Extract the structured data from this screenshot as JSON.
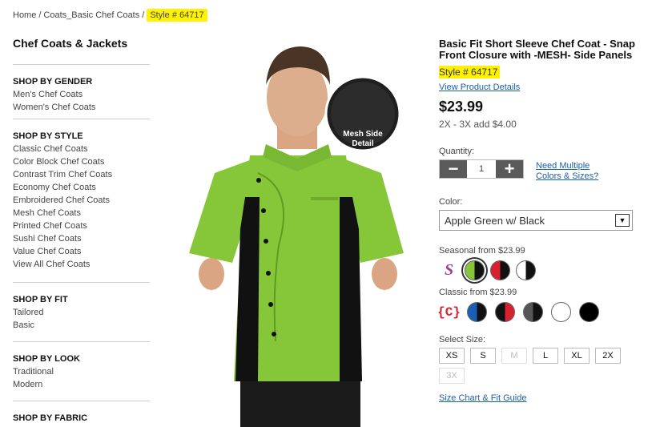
{
  "breadcrumb": {
    "home": "Home",
    "sep1": "/",
    "category": "Coats_Basic Chef Coats",
    "sep2": "/",
    "current": "Style # 64717"
  },
  "sidebar": {
    "title": "Chef Coats & Jackets",
    "sections": [
      {
        "title": "SHOP BY GENDER",
        "items": [
          "Men's Chef Coats",
          "Women's Chef Coats"
        ]
      },
      {
        "title": "SHOP BY STYLE",
        "items": [
          "Classic Chef Coats",
          "Color Block Chef Coats",
          "Contrast Trim Chef Coats",
          "Economy Chef Coats",
          "Embroidered Chef Coats",
          "Mesh Chef Coats",
          "Printed Chef Coats",
          "Sushi Chef Coats",
          "Value Chef Coats",
          "View All Chef Coats"
        ]
      },
      {
        "title": "SHOP BY FIT",
        "items": [
          "Tailored",
          "Basic"
        ]
      },
      {
        "title": "SHOP BY LOOK",
        "items": [
          "Traditional",
          "Modern"
        ]
      },
      {
        "title": "SHOP BY FABRIC",
        "items": []
      }
    ]
  },
  "image": {
    "badge_line1": "Mesh Side",
    "badge_line2": "Detail"
  },
  "product": {
    "title": "Basic Fit Short Sleeve Chef Coat - Snap Front Closure with -MESH- Side Panels",
    "style": "Style # 64717",
    "details_link": "View Product Details",
    "price": "$23.99",
    "price_note": "2X - 3X add $4.00",
    "quantity_label": "Quantity:",
    "quantity_value": "1",
    "minus": "−",
    "plus": "+",
    "need_multiple_1": "Need Multiple",
    "need_multiple_2": "Colors & Sizes?",
    "color_label": "Color:",
    "color_value": "Apple Green w/ Black",
    "seasonal_label": "Seasonal from $23.99",
    "classic_label": "Classic from $23.99",
    "seasonal_logo": "S",
    "classic_logo": "{C}",
    "size_label": "Select Size:",
    "sizes": [
      "XS",
      "S",
      "M",
      "L",
      "XL",
      "2X",
      "3X"
    ],
    "size_chart_link": "Size Chart & Fit Guide"
  },
  "colors": {
    "highlight": "#fff200",
    "coat_green": "#86c73a",
    "panel_black": "#111111",
    "link_blue": "#1a5fa8",
    "seasonal_swatches": [
      "#86c73a|#111111",
      "#d8202f|#111111",
      "#ffffff|#111111"
    ],
    "classic_swatches": [
      "#1a5fb4|#111111",
      "#d8202f|#111111",
      "#555555|#111111",
      "#ffffff",
      "#000000"
    ]
  }
}
